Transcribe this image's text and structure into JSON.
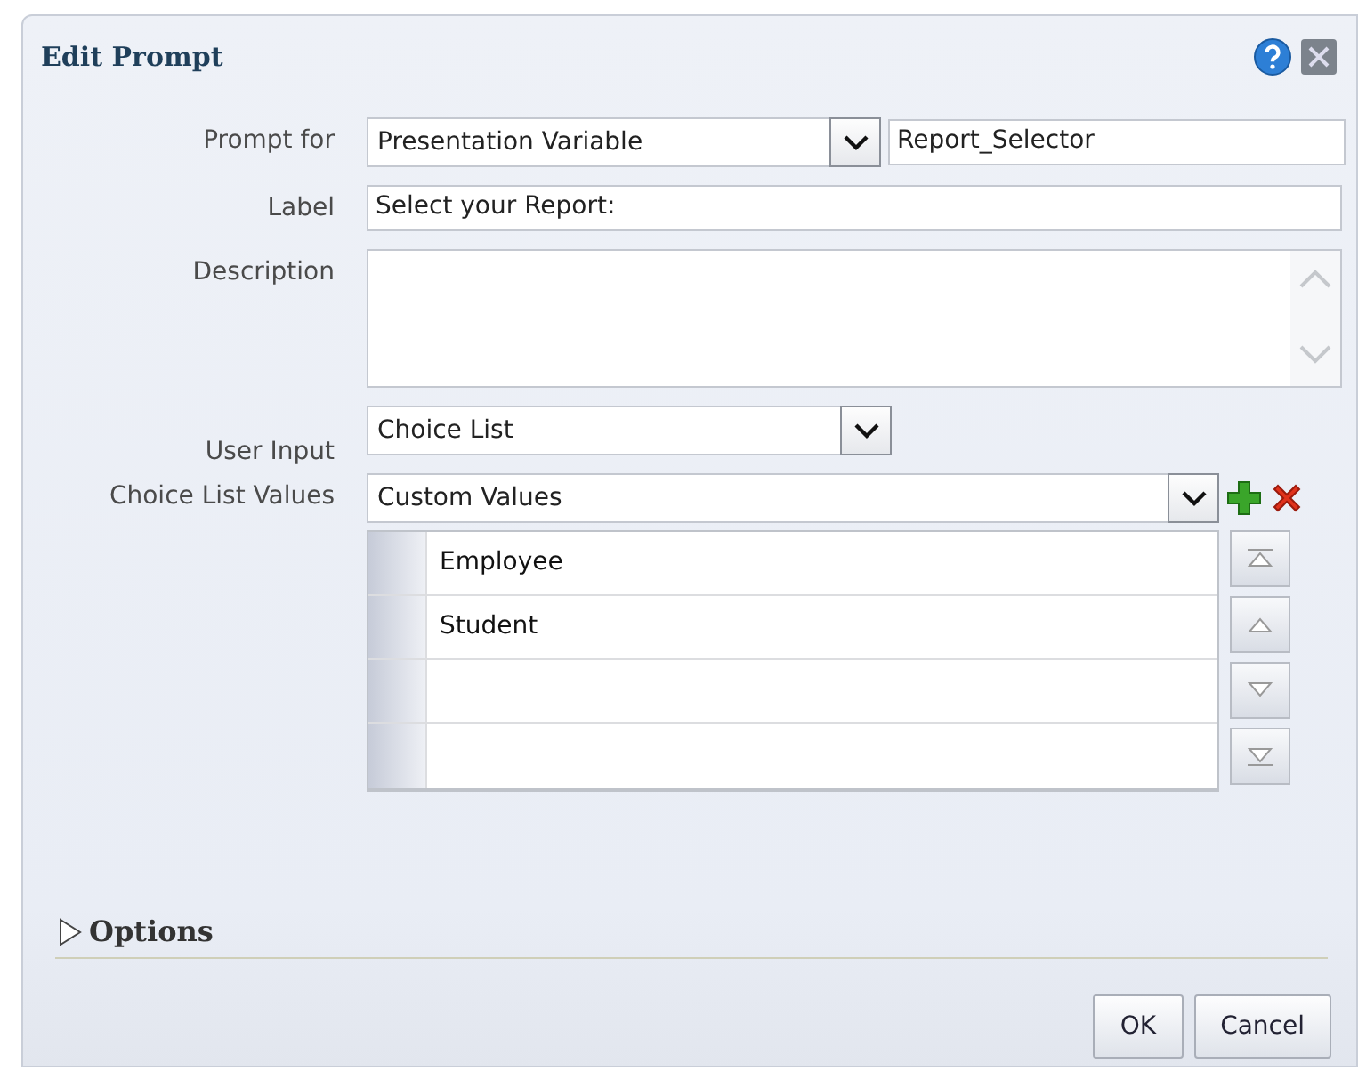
{
  "dialog": {
    "title": "Edit Prompt"
  },
  "fields": [
    {
      "kind": "select-text",
      "label": "Prompt for",
      "value": "Presentation Variable",
      "value_2": "Report_Selector"
    },
    {
      "kind": "text",
      "label": "Label",
      "value": "Select your Report:"
    },
    {
      "kind": "textarea",
      "label": "Description"
    },
    {
      "kind": "select",
      "label": "User Input",
      "value": "Choice List"
    },
    {
      "kind": "choice-select",
      "label": "Choice List Values",
      "value": "Custom Values"
    }
  ],
  "values_table": {
    "rows": [
      {
        "value": "Employee"
      },
      {
        "value": "Student"
      },
      {},
      {}
    ]
  },
  "options": {
    "label": "Options",
    "expanded": false
  },
  "buttons": [
    "OK",
    "Cancel"
  ]
}
